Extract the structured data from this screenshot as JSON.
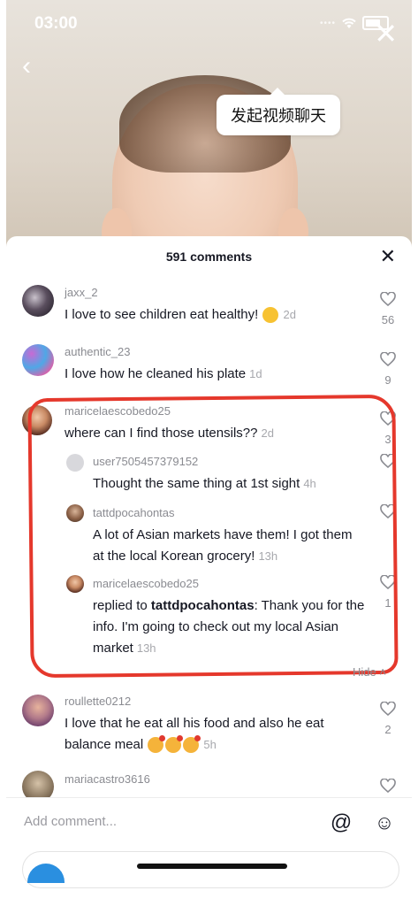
{
  "status": {
    "time": "03:00"
  },
  "tooltip": "发起视频聊天",
  "comments_header": {
    "title": "591 comments"
  },
  "comments": [
    {
      "user": "jaxx_2",
      "text": "I love to see children eat healthy!",
      "time": "2d",
      "likes": "56"
    },
    {
      "user": "authentic_23",
      "text": "I love how he cleaned his plate",
      "time": "1d",
      "likes": "9"
    },
    {
      "user": "maricelaescobedo25",
      "text": "where can I find those utensils??",
      "time": "2d",
      "likes": "3"
    },
    {
      "user": "user7505457379152",
      "text": "Thought the same thing at 1st sight",
      "time": "4h"
    },
    {
      "user": "tattdpocahontas",
      "text": "A lot of Asian markets have them! I got them at the local Korean grocery!",
      "time": "13h"
    },
    {
      "user": "maricelaescobedo25",
      "reply_prefix": "replied to",
      "reply_to": "tattdpocahontas",
      "text": ": Thank you for the info. I'm going to check out my local Asian market",
      "time": "13h",
      "likes": "1"
    },
    {
      "user": "roullette0212",
      "text": "I love that he eat all his food and also he eat balance meal",
      "time": "5h",
      "likes": "2"
    },
    {
      "user": "mariacastro3616"
    }
  ],
  "hide_label": "Hide",
  "input": {
    "placeholder": "Add comment..."
  },
  "colors": {
    "annotation": "#e5382c",
    "text": "#161823",
    "muted": "#8a8b91"
  }
}
